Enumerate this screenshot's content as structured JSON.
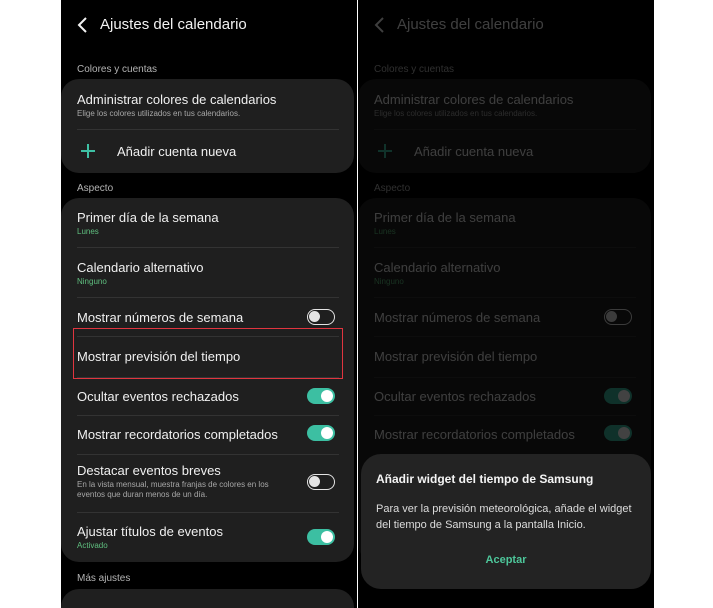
{
  "header": {
    "title": "Ajustes del calendario",
    "back_icon": "chevron-left-icon"
  },
  "sections": {
    "colors": "Colores y cuentas",
    "appearance": "Aspecto",
    "more": "Más ajustes"
  },
  "colors_card": {
    "manage_title": "Administrar colores de calendarios",
    "manage_sub": "Elige los colores utilizados en tus calendarios.",
    "add_account": "Añadir cuenta nueva",
    "add_icon": "plus-icon"
  },
  "appearance_card": {
    "first_day_title": "Primer día de la semana",
    "first_day_value": "Lunes",
    "alt_calendar_title": "Calendario alternativo",
    "alt_calendar_value": "Ninguno",
    "week_numbers_title": "Mostrar números de semana",
    "week_numbers_on": false,
    "weather_title": "Mostrar previsión del tiempo",
    "hide_declined_title": "Ocultar eventos rechazados",
    "hide_declined_on": true,
    "show_completed_title": "Mostrar recordatorios completados",
    "show_completed_on": true,
    "highlight_short_title": "Destacar eventos breves",
    "highlight_short_sub": "En la vista mensual, muestra franjas de colores en los eventos que duran menos de un día.",
    "highlight_short_on": false,
    "adjust_titles_title": "Ajustar títulos de eventos",
    "adjust_titles_value": "Activado",
    "adjust_titles_on": true
  },
  "dialog": {
    "title": "Añadir widget del tiempo de Samsung",
    "body": "Para ver la previsión meteorológica, añade el widget del tiempo de Samsung a la pantalla Inicio.",
    "button": "Aceptar"
  },
  "colors": {
    "accent": "#3cbfa2",
    "highlight": "#e0353f",
    "background": "#000000",
    "card": "#1f1f1f"
  }
}
